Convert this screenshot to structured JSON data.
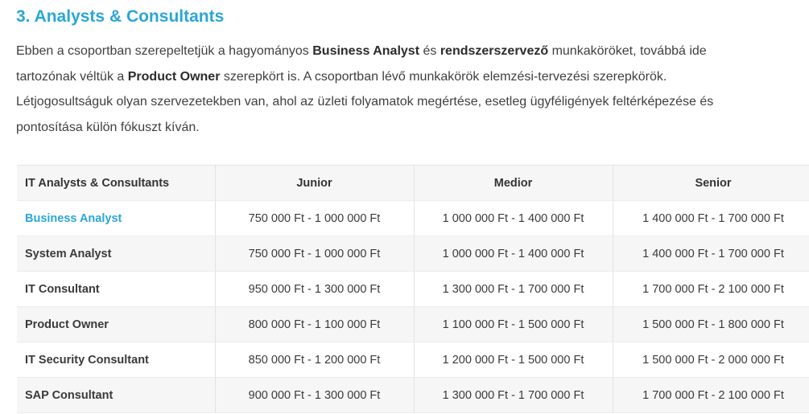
{
  "section": {
    "heading": "3. Analysts & Consultants",
    "intro": {
      "line1_a": "Ebben a csoportban szerepeltetjük a hagyományos ",
      "line1_b": "Business Analyst",
      "line1_c": " és ",
      "line1_d": "rendszerszervező",
      "line1_e": " munkaköröket, továbbá ide",
      "line2_a": "tartozónak véltük a ",
      "line2_b": "Product Owner",
      "line2_c": " szerepkört is. A csoportban lévő munkakörök elemzési-tervezési szerepkörök.",
      "line3": "Létjogosultságuk olyan szervezetekben van, ahol az üzleti folyamatok megértése, esetleg ügyféligények feltérképezése és",
      "line4": "pontosítása külön fókuszt kíván."
    }
  },
  "table": {
    "headers": [
      "IT Analysts & Consultants",
      "Junior",
      "Medior",
      "Senior"
    ],
    "rows": [
      {
        "role": "Business Analyst",
        "junior": "750 000 Ft - 1 000 000 Ft",
        "medior": "1 000 000 Ft - 1 400 000 Ft",
        "senior": "1 400 000 Ft - 1 700 000 Ft"
      },
      {
        "role": "System Analyst",
        "junior": "750 000 Ft - 1 000 000 Ft",
        "medior": "1 000 000 Ft - 1 400 000 Ft",
        "senior": "1 400 000 Ft - 1 700 000 Ft"
      },
      {
        "role": "IT Consultant",
        "junior": "950 000 Ft - 1 300 000 Ft",
        "medior": "1 300 000 Ft - 1 700 000 Ft",
        "senior": "1 700 000 Ft - 2 100 000 Ft"
      },
      {
        "role": "Product Owner",
        "junior": "800 000 Ft - 1 100 000 Ft",
        "medior": "1 100 000 Ft - 1 500 000 Ft",
        "senior": "1 500 000 Ft - 1 800 000 Ft"
      },
      {
        "role": "IT Security Consultant",
        "junior": "850 000 Ft - 1 200 000 Ft",
        "medior": "1 200 000 Ft - 1 500 000 Ft",
        "senior": "1 500 000 Ft - 2 000 000 Ft"
      },
      {
        "role": "SAP Consultant",
        "junior": "900 000 Ft - 1 300 000 Ft",
        "medior": "1 300 000 Ft - 1 700 000 Ft",
        "senior": "1 700 000 Ft - 2 100 000 Ft"
      }
    ]
  },
  "colors": {
    "accent": "#2aa6d9",
    "text": "#3a3a3a",
    "stripe": "#f6f6f6"
  }
}
